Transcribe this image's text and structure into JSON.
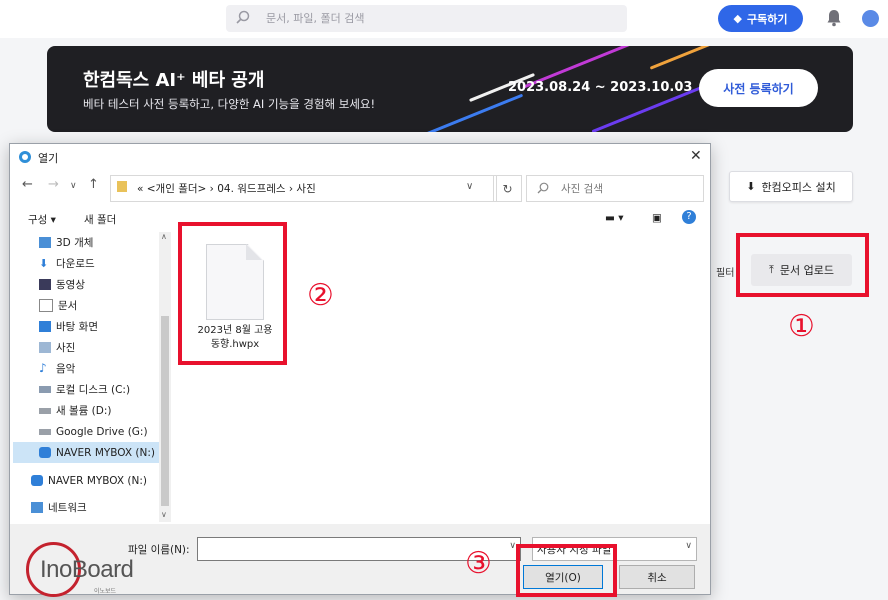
{
  "header": {
    "search_placeholder": "문서, 파일, 폴더 검색",
    "subscribe_label": "구독하기"
  },
  "banner": {
    "title": "한컴독스 AI⁺ 베타 공개",
    "subtitle": "베타 테스터 사전 등록하고, 다양한 AI 기능을 경험해 보세요!",
    "dates": "2023.08.24 ~ 2023.10.03",
    "cta_label": "사전 등록하기"
  },
  "app": {
    "install_label": "한컴오피스 설치",
    "filter_label": "필터",
    "upload_label": "문서 업로드"
  },
  "annotations": {
    "one": "①",
    "two": "②",
    "three": "③"
  },
  "dialog": {
    "title": "열기",
    "close": "✕",
    "path": "«  <개인 폴더>  ›  04. 워드프레스  ›  사진",
    "search_placeholder": "사진 검색",
    "organize_label": "구성 ▾",
    "new_folder_label": "새 폴더",
    "sidebar": [
      {
        "label": "3D 개체",
        "icon": "cube-icon"
      },
      {
        "label": "다운로드",
        "icon": "download-icon"
      },
      {
        "label": "동영상",
        "icon": "video-icon"
      },
      {
        "label": "문서",
        "icon": "document-icon"
      },
      {
        "label": "바탕 화면",
        "icon": "desktop-icon"
      },
      {
        "label": "사진",
        "icon": "picture-icon"
      },
      {
        "label": "음악",
        "icon": "music-icon"
      },
      {
        "label": "로컬 디스크 (C:)",
        "icon": "disk-icon"
      },
      {
        "label": "새 볼륨 (D:)",
        "icon": "drive-icon"
      },
      {
        "label": "Google Drive (G:)",
        "icon": "drive-icon"
      },
      {
        "label": "NAVER MYBOX (N:)",
        "icon": "mybox-icon",
        "selected": true
      },
      {
        "label": "NAVER MYBOX (N:)",
        "icon": "mybox-icon"
      },
      {
        "label": "네트워크",
        "icon": "network-icon"
      }
    ],
    "file": {
      "name": "2023년 8월 고용 동향.hwpx"
    },
    "filename_label": "파일 이름(N):",
    "filename_value": "",
    "filetype_value": "사용자 지정 파일",
    "open_label": "열기(O)",
    "cancel_label": "취소"
  },
  "watermark": {
    "brand": "InoBoard",
    "sub": "이노보드"
  },
  "colors": {
    "accent": "#2f67e8",
    "highlight": "#e8112d",
    "banner_bg": "#1f1f23"
  }
}
